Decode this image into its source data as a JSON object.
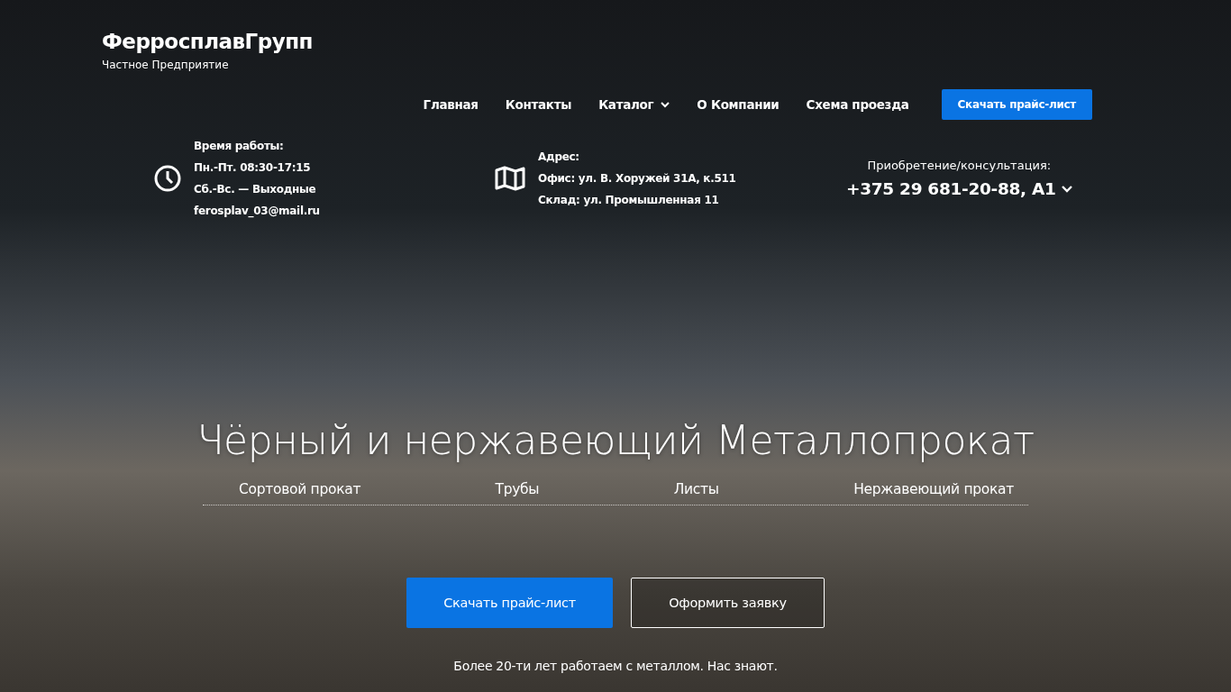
{
  "logo": {
    "title": "ФерросплавГрупп",
    "subtitle": "Частное Предприятие"
  },
  "nav": [
    {
      "label": "Главная",
      "dropdown": false
    },
    {
      "label": "Контакты",
      "dropdown": false
    },
    {
      "label": "Каталог",
      "dropdown": true
    },
    {
      "label": "О Компании",
      "dropdown": false
    },
    {
      "label": "Схема проезда",
      "dropdown": false
    }
  ],
  "header_button": "Скачать прайс-лист",
  "hours": {
    "title": "Время работы:",
    "lines": [
      "Пн.-Пт. 08:30-17:15",
      "Сб.-Вс. — Выходные",
      "ferosplav_03@mail.ru"
    ]
  },
  "address": {
    "title": "Адрес:",
    "lines": [
      "Офис: ул. В. Хоружей 31А, к.511",
      "Склад: ул. Промышленная 11"
    ]
  },
  "contact": {
    "label": "Приобретение/консультация:",
    "phone": "+375 29 681-20-88, A1"
  },
  "hero": {
    "title": "Чёрный и нержавеющий Металлопрокат",
    "categories": [
      "Сортовой прокат",
      "Трубы",
      "Листы",
      "Нержавеющий прокат"
    ],
    "buttons": [
      {
        "label": "Скачать прайс-лист",
        "kind": "primary"
      },
      {
        "label": "Оформить заявку",
        "kind": "outline"
      }
    ],
    "tagline": "Более 20-ти лет работаем с металлом. Нас знают."
  }
}
